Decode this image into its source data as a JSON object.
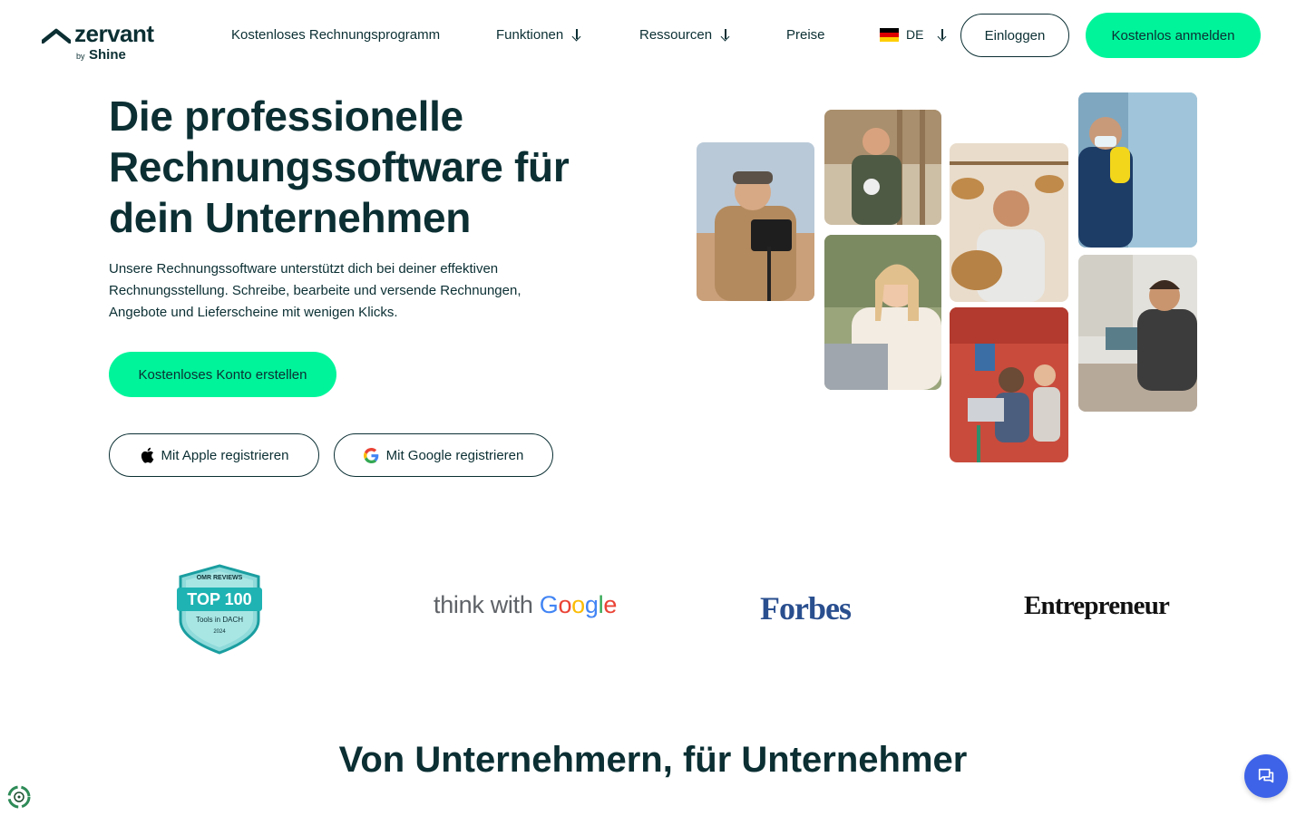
{
  "header": {
    "brand": "zervant",
    "brand_by": "by",
    "brand_parent": "Shine",
    "nav": {
      "free_program": "Kostenloses Rechnungsprogramm",
      "functions": "Funktionen",
      "resources": "Ressourcen",
      "prices": "Preise"
    },
    "language": "DE",
    "login": "Einloggen",
    "signup": "Kostenlos anmelden"
  },
  "hero": {
    "title": "Die professionelle Rechnungssoftware für dein Unternehmen",
    "text": "Unsere Rechnungssoftware unterstützt dich bei deiner effektiven Rechnungsstellung. Schreibe, bearbeite und versende Rechnungen, Angebote und Lieferscheine mit wenigen Klicks.",
    "cta": "Kostenloses Konto erstellen",
    "apple": "Mit Apple registrieren",
    "google": "Mit Google registrieren"
  },
  "logos": {
    "omr_brand": "OMR REVIEWS",
    "omr_top": "TOP 100",
    "omr_sub": "Tools in DACH",
    "omr_year": "2024",
    "twg_prefix": "think with ",
    "twg_g": [
      "G",
      "o",
      "o",
      "g",
      "l",
      "e"
    ],
    "forbes": "Forbes",
    "entrepreneur": "Entrepreneur"
  },
  "section": {
    "title": "Von Unternehmern, für Unternehmer"
  },
  "colors": {
    "primary_text": "#0b2f33",
    "accent_green": "#00f59b",
    "chat_blue": "#3e63e8"
  }
}
